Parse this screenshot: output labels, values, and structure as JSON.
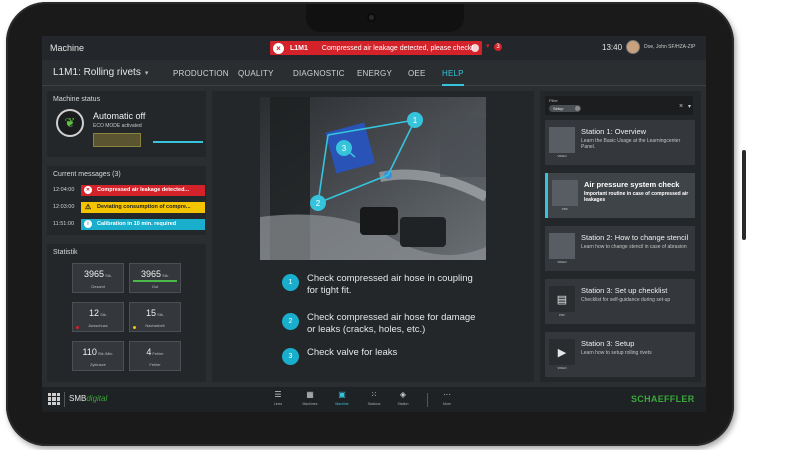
{
  "titlebar": {
    "app_title": "Machine",
    "alarm_code": "L1M1",
    "alarm_text": "Compressed air leakage detected, please check!",
    "alarm_count": "3",
    "time": "13:40",
    "user": "Doe, John SF/HZA-ZIP"
  },
  "nav": {
    "machine": "L1M1: Rolling rivets",
    "tabs": [
      "PRODUCTION",
      "QUALITY",
      "DIAGNOSTIC",
      "ENERGY",
      "OEE",
      "HELP"
    ],
    "active_tab": "HELP"
  },
  "machine_status": {
    "title": "Machine status",
    "mode": "Automatic off",
    "sub": "ECO MODE activated"
  },
  "messages": {
    "title": "Current messages (3)",
    "items": [
      {
        "time": "12:04:00",
        "text": "Compressed air leakage detected...",
        "severity": "error"
      },
      {
        "time": "12:03:00",
        "text": "Deviating consumption of compre...",
        "severity": "warning"
      },
      {
        "time": "11:51:00",
        "text": "Calibration in 10 min. required",
        "severity": "info"
      }
    ]
  },
  "statistik": {
    "title": "Statistik",
    "tiles": [
      {
        "value": "3965",
        "unit": "Stk.",
        "label": "Gesamt"
      },
      {
        "value": "3965",
        "unit": "Stk.",
        "label": "Gut"
      },
      {
        "value": "12",
        "unit": "Stk.",
        "label": "Ausschuss"
      },
      {
        "value": "15",
        "unit": "Stk.",
        "label": "Nacharbeit"
      },
      {
        "value": "110",
        "unit": "Stk./Min.",
        "label": "Zyklusze"
      },
      {
        "value": "4",
        "unit": "Fehler",
        "label": "Fehler"
      }
    ]
  },
  "help_steps": [
    {
      "num": "1",
      "text": "Check compressed air hose in coupling for tight fit."
    },
    {
      "num": "2",
      "text": "Check compressed air hose for damage or leaks (cracks, holes, etc.)"
    },
    {
      "num": "3",
      "text": "Check valve for leaks"
    }
  ],
  "photo_markers": [
    "1",
    "2",
    "3"
  ],
  "filter": {
    "label": "Filter",
    "chip": "Setup"
  },
  "help_cards": [
    {
      "title": "Station 1: Overview",
      "desc": "Learn the Basic Usage at the Learningcenter Panel.",
      "tag": "VIDEO"
    },
    {
      "title": "Air pressure system check",
      "desc": "Important routine in case of compressed air leakages",
      "tag": "PDF"
    },
    {
      "title": "Station 2: How to change stencil",
      "desc": "Learn how to change stencil in case of abrasion",
      "tag": "VIDEO"
    },
    {
      "title": "Station 3: Set up checklist",
      "desc": "Checklist for self-guidance during set-up",
      "tag": "PDF"
    },
    {
      "title": "Station 3: Setup",
      "desc": "Learn how to setup rolling rivets",
      "tag": "VIDEO"
    }
  ],
  "bottombar": {
    "brand_main": "SMB",
    "brand_accent": "digital",
    "dock": [
      "Lines",
      "Machines",
      "Machine",
      "Stations",
      "Station",
      "More"
    ],
    "active_dock": "Machine",
    "logo": "SCHAEFFLER"
  },
  "colors": {
    "accent": "#35c4dc",
    "error": "#d4222a",
    "warning": "#f5c400",
    "info": "#19aecb",
    "brand_green": "#3aa63b"
  }
}
